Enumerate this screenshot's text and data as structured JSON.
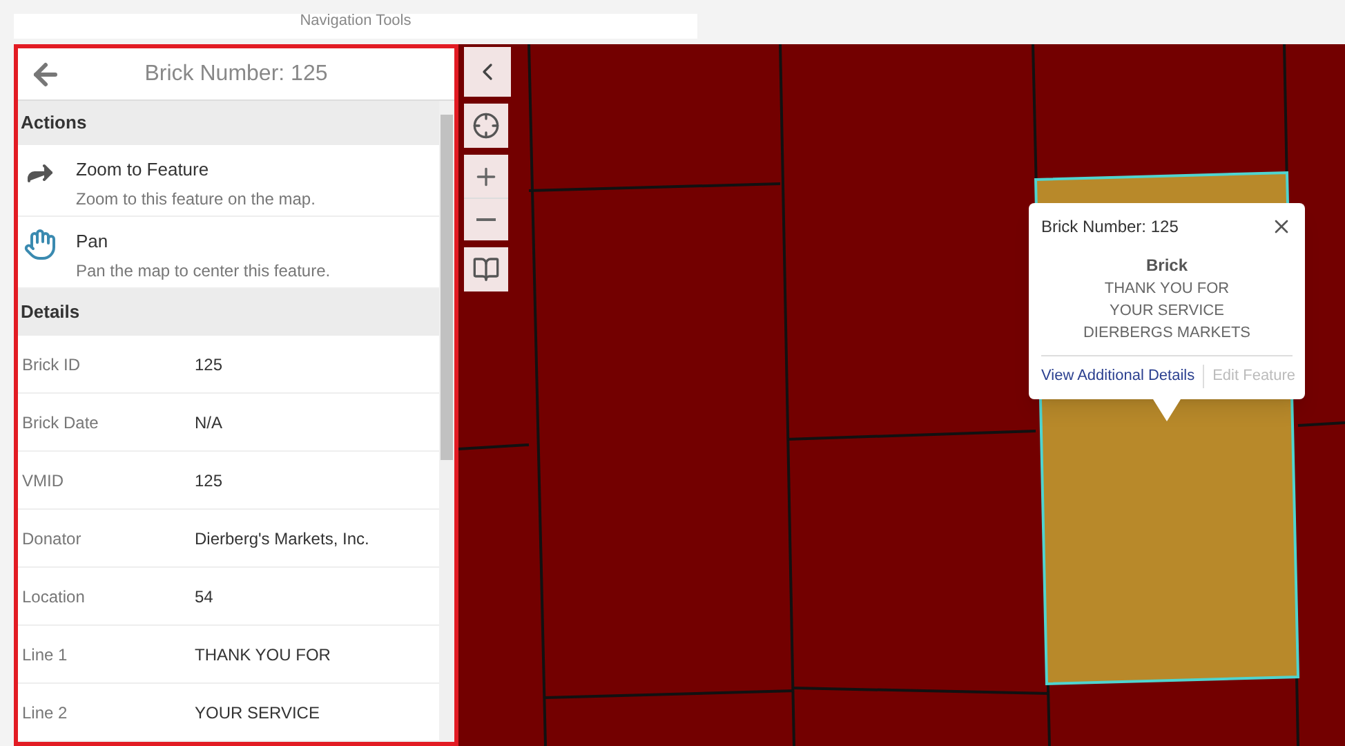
{
  "top_bar": {
    "title": "Navigation Tools"
  },
  "panel": {
    "title": "Brick Number: 125",
    "actions_heading": "Actions",
    "actions": [
      {
        "kind": "zoom",
        "label": "Zoom to Feature",
        "description": "Zoom to this feature on the map."
      },
      {
        "kind": "pan",
        "label": "Pan",
        "description": "Pan the map to center this feature."
      }
    ],
    "details_heading": "Details",
    "details": [
      {
        "label": "Brick ID",
        "value": "125"
      },
      {
        "label": "Brick Date",
        "value": "N/A"
      },
      {
        "label": "VMID",
        "value": "125"
      },
      {
        "label": "Donator",
        "value": "Dierberg's Markets, Inc."
      },
      {
        "label": "Location",
        "value": "54"
      },
      {
        "label": "Line 1",
        "value": "THANK YOU FOR"
      },
      {
        "label": "Line 2",
        "value": "YOUR SERVICE"
      }
    ]
  },
  "popup": {
    "title": "Brick Number: 125",
    "heading": "Brick",
    "lines": [
      "THANK YOU FOR",
      "YOUR SERVICE",
      "DIERBERGS MARKETS"
    ],
    "links": [
      {
        "label": "View Additional Details",
        "disabled": false
      },
      {
        "label": "Edit Feature",
        "disabled": true
      }
    ]
  }
}
